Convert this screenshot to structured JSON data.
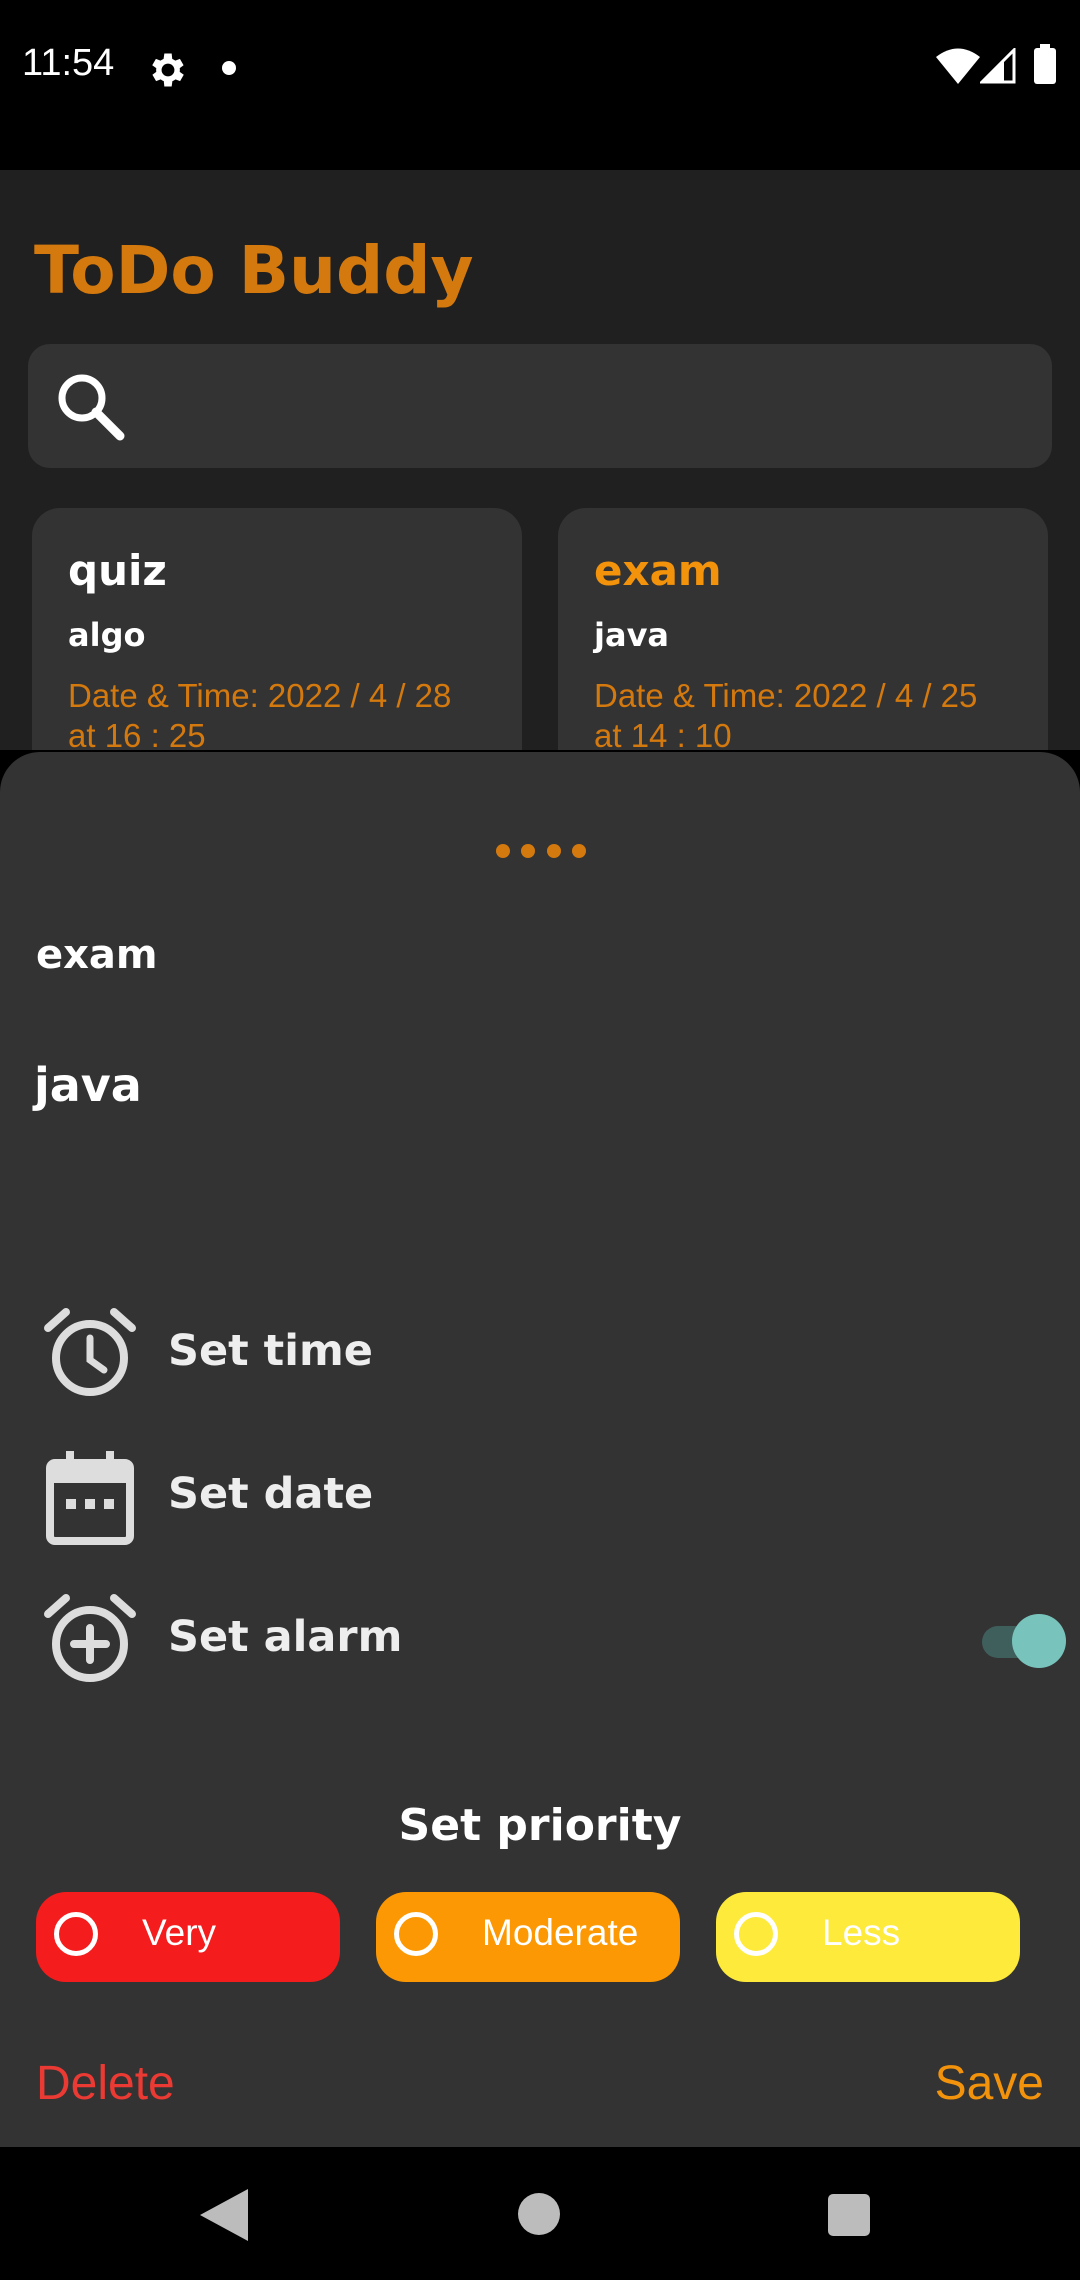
{
  "status_bar": {
    "time": "11:54",
    "icons": [
      "settings-gear-icon",
      "notification-dot-icon",
      "wifi-icon",
      "cell-signal-icon",
      "battery-icon"
    ]
  },
  "app": {
    "title": "ToDo Buddy",
    "search": {
      "icon": "search-icon",
      "value": ""
    },
    "cards": [
      {
        "title": "quiz",
        "subtitle": "algo",
        "date": "Date & Time:  2022 / 4 / 28  at  16 : 25"
      },
      {
        "title": "exam",
        "subtitle": "java",
        "date": "Date & Time:  2022 / 4 / 25  at  14 : 10"
      }
    ]
  },
  "sheet": {
    "task_title": "exam",
    "task_description": "java",
    "options": {
      "set_time": "Set time",
      "set_date": "Set date",
      "set_alarm": "Set alarm"
    },
    "alarm_enabled": true,
    "priority": {
      "title": "Set priority",
      "very": "Very",
      "moderate": "Moderate",
      "less": "Less"
    },
    "delete_label": "Delete",
    "save_label": "Save"
  },
  "colors": {
    "accent": "#d4790e",
    "very": "#f41c1c",
    "moderate": "#fb9803",
    "less": "#fdea3b",
    "delete": "#ea3a33",
    "save": "#f3930c",
    "toggle": "#79c3bd"
  }
}
